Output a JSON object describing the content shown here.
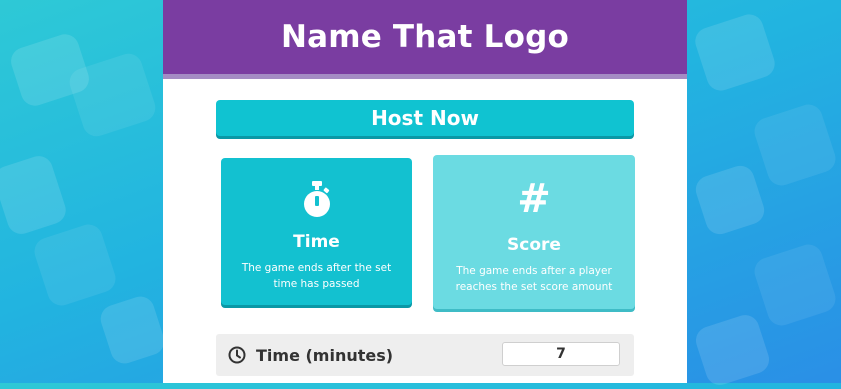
{
  "header": {
    "title": "Name That Logo"
  },
  "host_button": {
    "label": "Host Now"
  },
  "modes": [
    {
      "label": "Time",
      "description": "The game ends after the set time has passed",
      "icon": "stopwatch-icon"
    },
    {
      "label": "Score",
      "description": "The game ends after a player reaches the set score amount",
      "icon": "hash-icon",
      "icon_glyph": "#"
    }
  ],
  "time_setting": {
    "label": "Time (minutes)",
    "value": "7",
    "icon": "clock-icon"
  },
  "colors": {
    "header": "#7a3da1",
    "accent": "#13c1d0",
    "accent_light": "#6bdbe2"
  }
}
